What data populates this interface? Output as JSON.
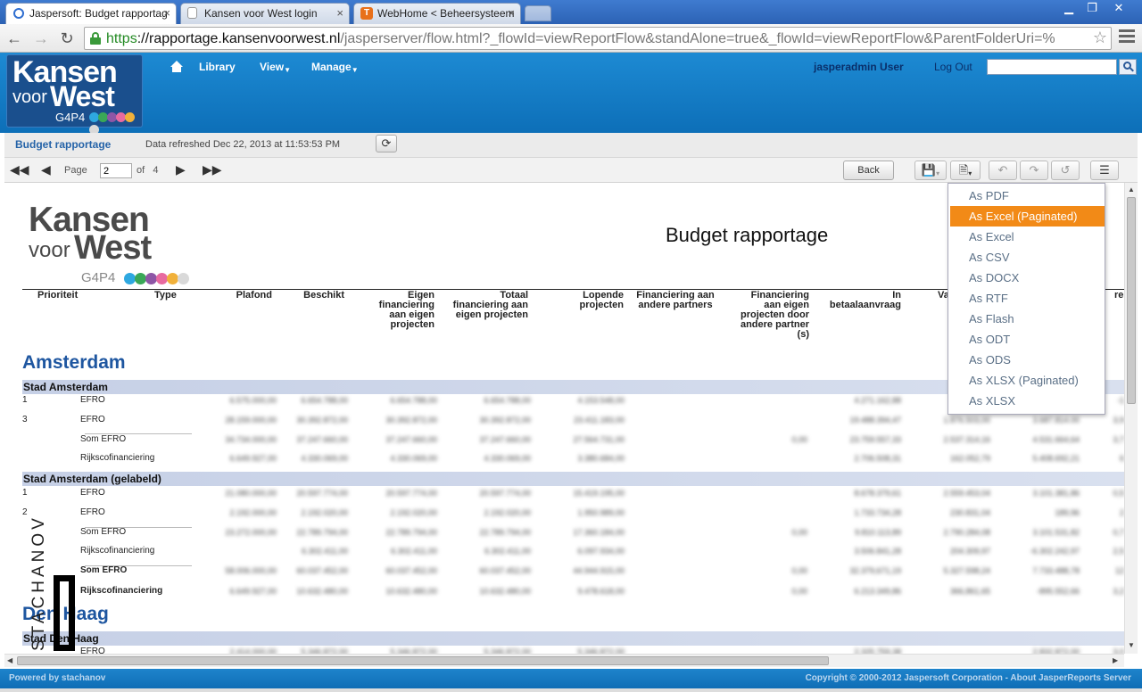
{
  "browser": {
    "tabs": [
      {
        "title": "Jaspersoft: Budget rapportag",
        "active": true
      },
      {
        "title": "Kansen voor West login",
        "active": false
      },
      {
        "title": "WebHome < Beheersysteem",
        "active": false
      }
    ],
    "url_proto": "https",
    "url_host": "://rapportage.kansenvoorwest.nl",
    "url_path": "/jasperserver/flow.html?_flowId=viewReportFlow&standAlone=true&_flowId=viewReportFlow&ParentFolderUri=%"
  },
  "header": {
    "logo": {
      "line1": "Kansen",
      "line2a": "voor",
      "line2b": "West",
      "line3": "G4P4",
      "dot_colors": [
        "#2ea8e0",
        "#3aa857",
        "#8e56a6",
        "#e86aa0",
        "#f1b13a",
        "#d9d9d9"
      ]
    },
    "nav": [
      "Library",
      "View",
      "Manage"
    ],
    "user": "jasperadmin User",
    "logout": "Log Out",
    "search_value": ""
  },
  "toolbar": {
    "report_title": "Budget rapportage",
    "refreshed": "Data refreshed Dec 22, 2013 at 11:53:53 PM",
    "page_label": "Page",
    "page_value": "2",
    "of_label": "of",
    "total_pages": "4",
    "back": "Back"
  },
  "report": {
    "logo": {
      "line1": "Kansen",
      "line2a": "voor",
      "line2b": "West",
      "line3": "G4P4",
      "dot_colors": [
        "#2ea8e0",
        "#3aa857",
        "#8e56a6",
        "#e86aa0",
        "#f1b13a",
        "#d9d9d9"
      ]
    },
    "title": "Budget rapportage",
    "columns": [
      "Prioriteit",
      "Type",
      "Plafond",
      "Beschikt",
      "Eigen\nfinanciering\naan eigen\nprojecten",
      "Totaal\nfinanciering aan\neigen projecten",
      "Lopende\nprojecten",
      "Financiering aan\nandere partners",
      "Financiering\naan eigen\nprojecten door\nandere partner\n(s)",
      "In\nbetaalaanvraag",
      "Va",
      "re"
    ],
    "groups": [
      {
        "name": "Amsterdam"
      },
      {
        "name": "Den Haag"
      }
    ],
    "subgroups": [
      "Stad Amsterdam",
      "Stad Amsterdam (gelabeld)",
      "Stad Den Haag"
    ],
    "rows": [
      {
        "prio": "1",
        "type": "EFRO",
        "vals": [
          "6.575.000,00",
          "6.654.788,00",
          "6.654.788,00",
          "6.654.788,00",
          "4.153.548,00",
          "",
          "",
          "4.271.162,88",
          "",
          "",
          "-1"
        ]
      },
      {
        "prio": "3",
        "type": "EFRO",
        "vals": [
          "28.159.000,00",
          "30.392.872,00",
          "30.392.872,00",
          "30.392.872,00",
          "23.411.183,00",
          "",
          "",
          "19.488.394,47",
          "1.876.503,00",
          "3.687.814.00",
          "3,9"
        ]
      },
      {
        "prio": "",
        "type": "Som EFRO",
        "vals": [
          "34.734.000,00",
          "37.247.660,00",
          "37.247.660,00",
          "37.247.660,00",
          "27.564.731,00",
          "",
          "0,00",
          "23.759.557,33",
          "2.537.314,16",
          "4.531.664,64",
          "3,7"
        ]
      },
      {
        "prio": "",
        "type": "Rijkscofinanciering",
        "vals": [
          "6.649.927,00",
          "4.330.069,00",
          "4.330.069,00",
          "4.330.069,00",
          "3.380.684,00",
          "",
          "",
          "2.706.508,31",
          "162.052,79",
          "5.408.692,21",
          "6"
        ]
      },
      {
        "prio": "1",
        "type": "EFRO",
        "vals": [
          "21.080.000,00",
          "20.597.774,00",
          "20.597.774,00",
          "20.597.774,00",
          "15.419.195,00",
          "",
          "",
          "8.678.379,61",
          "2.559.453,04",
          "3.101.381,86",
          "0,5"
        ]
      },
      {
        "prio": "2",
        "type": "EFRO",
        "vals": [
          "2.192.000,00",
          "2.192.020,00",
          "2.192.020,00",
          "2.192.020,00",
          "1.950.989,00",
          "",
          "",
          "1.733.734,28",
          "230.831,04",
          "189,96",
          "2"
        ]
      },
      {
        "prio": "",
        "type": "Som EFRO",
        "vals": [
          "23.272.000,00",
          "22.789.794,00",
          "22.789.794,00",
          "22.789.794,00",
          "17.360.184,00",
          "",
          "0,00",
          "9.810.113,89",
          "2.790.284,08",
          "3.101.531,82",
          "0,7"
        ]
      },
      {
        "prio": "",
        "type": "Rijkscofinanciering",
        "vals": [
          "",
          "6.302.411,00",
          "6.302.411,00",
          "6.302.411,00",
          "6.097.934,00",
          "",
          "",
          "3.506.841,28",
          "204.309,97",
          "-6.302.242,97",
          "2,5"
        ]
      },
      {
        "prio": "",
        "type": "Som EFRO",
        "bold": true,
        "vals": [
          "58.006.000,00",
          "60.037.452,00",
          "60.037.452,00",
          "60.037.452,00",
          "44.944.915,00",
          "",
          "0,00",
          "32.379,671,19",
          "5.327.598,24",
          "7.733.488,78",
          "12"
        ]
      },
      {
        "prio": "",
        "type": "Rijkscofinanciering",
        "bold": true,
        "vals": [
          "6.649.927,00",
          "10.632.480,00",
          "10.632.480,00",
          "10.632.480,00",
          "9.478.618,00",
          "",
          "0,00",
          "6.213.349,86",
          "366,861,65",
          "-895.552,66",
          "3,2"
        ]
      },
      {
        "prio": "",
        "type": "EFRO",
        "vals": [
          "2.414.000,00",
          "5.346.872,00",
          "5.346.872,00",
          "5.346.872,00",
          "5.346.872,00",
          "",
          "",
          "2.325.759,38",
          "",
          "2.832.872,00",
          "3,0"
        ]
      }
    ],
    "watermark": "STACHANOV"
  },
  "export_menu": {
    "items": [
      "As PDF",
      "As Excel (Paginated)",
      "As Excel",
      "As CSV",
      "As DOCX",
      "As RTF",
      "As Flash",
      "As ODT",
      "As ODS",
      "As XLSX (Paginated)",
      "As XLSX"
    ],
    "active_index": 1,
    "accent": "#f28a17"
  },
  "footer": {
    "left": "Powered by stachanov",
    "right": "Copyright © 2000-2012 Jaspersoft Corporation - About JasperReports Server"
  }
}
